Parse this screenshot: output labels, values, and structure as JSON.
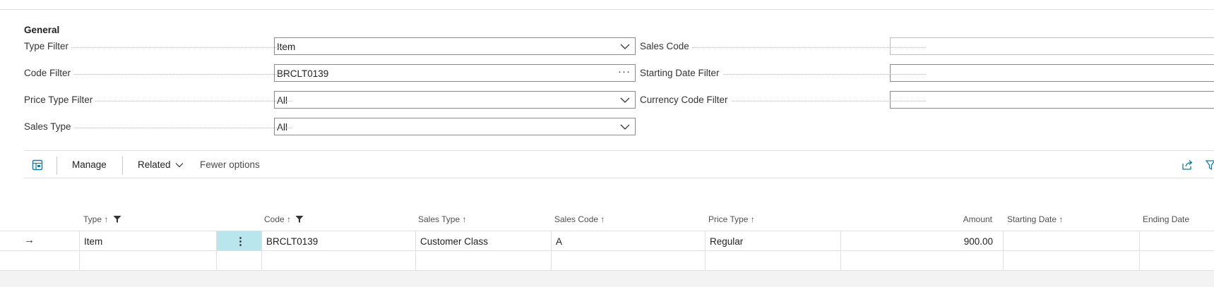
{
  "general": {
    "title": "General",
    "left_fields": [
      {
        "label": "Type Filter",
        "value": "Item",
        "control": "dropdown"
      },
      {
        "label": "Code Filter",
        "value": "BRCLT0139",
        "control": "lookup"
      },
      {
        "label": "Price Type Filter",
        "value": "All",
        "control": "dropdown"
      },
      {
        "label": "Sales Type",
        "value": "All",
        "control": "dropdown"
      }
    ],
    "right_fields": [
      {
        "label": "Sales Code",
        "value": "",
        "control": "dropdown"
      },
      {
        "label": "Starting Date Filter",
        "value": "",
        "control": "text"
      },
      {
        "label": "Currency Code Filter",
        "value": "",
        "control": "dropdown"
      }
    ]
  },
  "actions": {
    "manage": "Manage",
    "related": "Related",
    "fewer_options": "Fewer options"
  },
  "table": {
    "columns": {
      "type": "Type ↑",
      "code": "Code ↑",
      "sales_type": "Sales Type ↑",
      "sales_code": "Sales Code ↑",
      "price_type": "Price Type ↑",
      "amount": "Amount",
      "starting_date": "Starting Date ↑",
      "ending_date": "Ending Date"
    },
    "rows": [
      {
        "type": "Item",
        "code": "BRCLT0139",
        "sales_type": "Customer Class",
        "sales_code": "A",
        "price_type": "Regular",
        "amount": "900.00",
        "starting_date": "",
        "ending_date": ""
      }
    ],
    "row_menu": "⋮",
    "row_arrow": "→"
  }
}
